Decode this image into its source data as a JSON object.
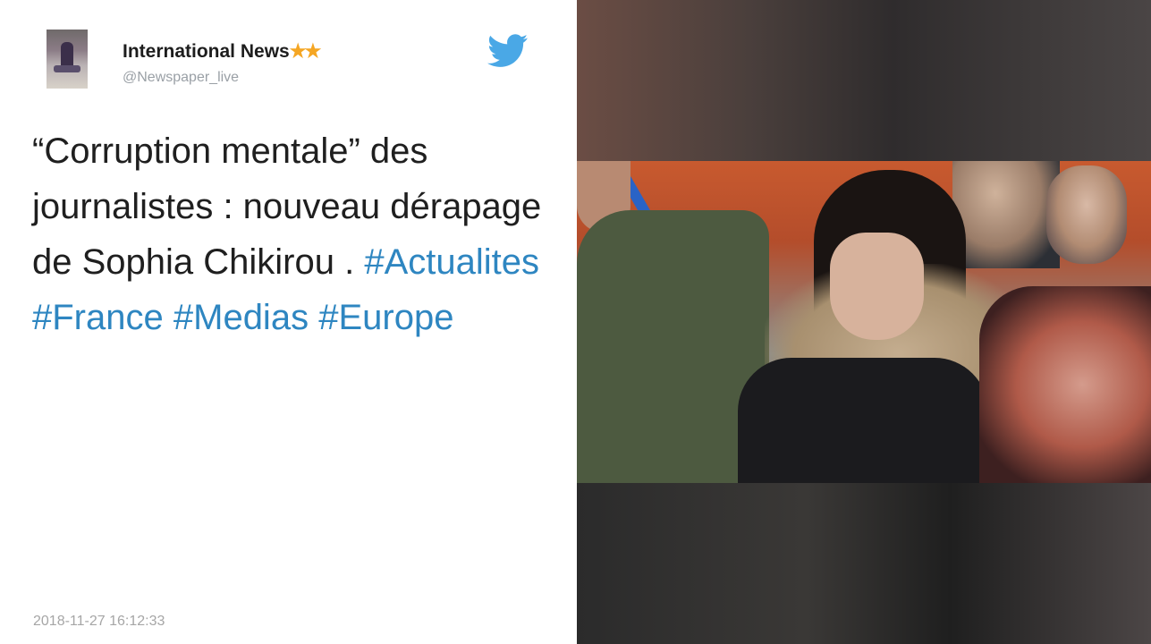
{
  "tweet": {
    "name": "International News",
    "stars": "★★",
    "handle": "@Newspaper_live",
    "text": "“Corruption mentale” des journalistes : nouveau dérapage de Sophia Chikirou . ",
    "hashtags": [
      "#Actualites",
      "#France",
      "#Medias",
      "#Europe"
    ],
    "timestamp": "2018-11-27 16:12:33"
  },
  "colors": {
    "link": "#2e86c1",
    "twitter_blue": "#4aa8e6",
    "star": "#f5a623"
  },
  "icons": {
    "brand": "twitter-bird-icon"
  }
}
